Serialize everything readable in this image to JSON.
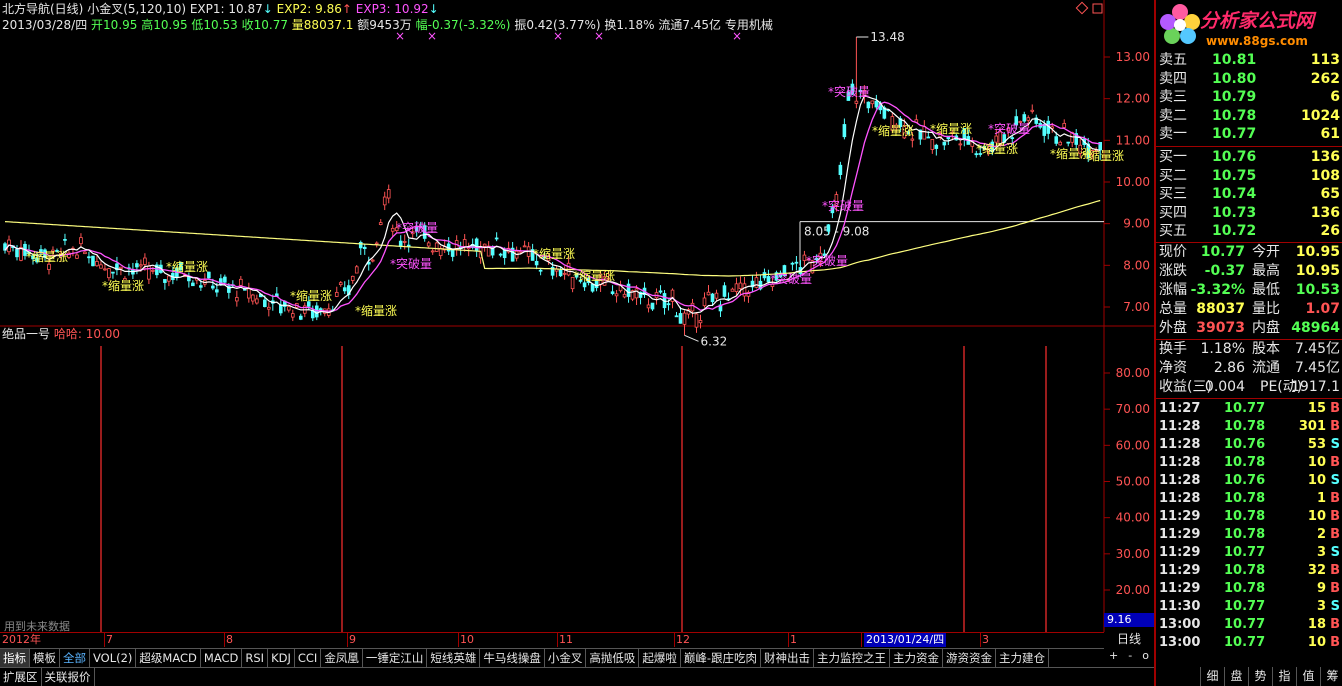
{
  "header": {
    "title": "北方导航(日线)",
    "indicator": "小金叉(5,120,10)",
    "exp1_label": "EXP1: 10.87",
    "exp1_arrow": "↓",
    "exp2_label": "EXP2: 9.86",
    "exp2_arrow": "↑",
    "exp3_label": "EXP3: 10.92",
    "exp3_arrow": "↓",
    "date": "2013/03/28/四",
    "open": "开10.95",
    "high": "高10.95",
    "low": "低10.53",
    "close": "收10.77",
    "volume": "量88037.1",
    "amount": "额9453万",
    "change": "幅-0.37(-3.32%)",
    "amplitude": "振0.42(3.77%)",
    "turnover": "换1.18%",
    "float": "流通7.45亿",
    "sector": "专用机械"
  },
  "sub": {
    "name": "绝品一号",
    "value": "哈哈: 10.00",
    "note": "用到未来数据"
  },
  "price_axis": [
    "13.00",
    "12.00",
    "11.00",
    "10.00",
    "9.00",
    "8.00",
    "7.00"
  ],
  "sub_axis": [
    "80.00",
    "70.00",
    "60.00",
    "50.00",
    "40.00",
    "30.00",
    "20.00"
  ],
  "sub_axis_last": "9.16",
  "annotations": {
    "high_label": "13.48",
    "low_label": "6.32",
    "range_label": "8.05 - 9.08",
    "shrink_up": "缩量涨",
    "breakout": "突破量"
  },
  "dates": {
    "labels": [
      "2012年",
      "7",
      "8",
      "9",
      "10",
      "11",
      "12",
      "1",
      "2",
      "3"
    ],
    "highlight": "2013/01/24/四",
    "period": "日线"
  },
  "zoom": [
    "+",
    "-",
    "o"
  ],
  "tabs": [
    "指标",
    "模板",
    "全部",
    "VOL(2)",
    "超级MACD",
    "MACD",
    "RSI",
    "KDJ",
    "CCI",
    "金凤凰",
    "一锤定江山",
    "短线英雄",
    "牛马线操盘",
    "小金叉",
    "高抛低吸",
    "起爆啦",
    "巅峰-跟庄吃肉",
    "财神出击",
    "主力监控之王",
    "主力资金",
    "游资资金",
    "主力建仓"
  ],
  "bottom_tabs": [
    "扩展区",
    "关联报价"
  ],
  "logo": {
    "text": "分析家公式网",
    "url": "www.88gs.com"
  },
  "orders": {
    "sell": [
      {
        "label": "卖五",
        "price": "10.81",
        "vol": "113"
      },
      {
        "label": "卖四",
        "price": "10.80",
        "vol": "262"
      },
      {
        "label": "卖三",
        "price": "10.79",
        "vol": "6"
      },
      {
        "label": "卖二",
        "price": "10.78",
        "vol": "1024"
      },
      {
        "label": "卖一",
        "price": "10.77",
        "vol": "61"
      }
    ],
    "buy": [
      {
        "label": "买一",
        "price": "10.76",
        "vol": "136"
      },
      {
        "label": "买二",
        "price": "10.75",
        "vol": "108"
      },
      {
        "label": "买三",
        "price": "10.74",
        "vol": "65"
      },
      {
        "label": "买四",
        "price": "10.73",
        "vol": "136"
      },
      {
        "label": "买五",
        "price": "10.72",
        "vol": "26"
      }
    ]
  },
  "quote": [
    {
      "l1": "现价",
      "v1": "10.77",
      "c1": "#54ff54",
      "l2": "今开",
      "v2": "10.95",
      "c2": "#ffff54"
    },
    {
      "l1": "涨跌",
      "v1": "-0.37",
      "c1": "#54ff54",
      "l2": "最高",
      "v2": "10.95",
      "c2": "#ffff54"
    },
    {
      "l1": "涨幅",
      "v1": "-3.32%",
      "c1": "#54ff54",
      "l2": "最低",
      "v2": "10.53",
      "c2": "#54ff54"
    },
    {
      "l1": "总量",
      "v1": "88037",
      "c1": "#ffff54",
      "l2": "量比",
      "v2": "1.07",
      "c2": "#ff5454"
    },
    {
      "l1": "外盘",
      "v1": "39073",
      "c1": "#ff5454",
      "l2": "内盘",
      "v2": "48964",
      "c2": "#54ff54"
    }
  ],
  "stats": [
    {
      "l1": "换手",
      "v1": "1.18%",
      "l2": "股本",
      "v2": "7.45亿"
    },
    {
      "l1": "净资",
      "v1": "2.86",
      "l2": "流通",
      "v2": "7.45亿"
    },
    {
      "l1": "收益(三)",
      "v1": "0.004",
      "l2": "PE(动)",
      "v2": "1917.1"
    }
  ],
  "ticks": [
    {
      "t": "11:27",
      "p": "10.77",
      "v": "15",
      "s": "B"
    },
    {
      "t": "11:28",
      "p": "10.78",
      "v": "301",
      "s": "B"
    },
    {
      "t": "11:28",
      "p": "10.76",
      "v": "53",
      "s": "S"
    },
    {
      "t": "11:28",
      "p": "10.78",
      "v": "10",
      "s": "B"
    },
    {
      "t": "11:28",
      "p": "10.76",
      "v": "10",
      "s": "S"
    },
    {
      "t": "11:28",
      "p": "10.78",
      "v": "1",
      "s": "B"
    },
    {
      "t": "11:29",
      "p": "10.78",
      "v": "10",
      "s": "B"
    },
    {
      "t": "11:29",
      "p": "10.78",
      "v": "2",
      "s": "B"
    },
    {
      "t": "11:29",
      "p": "10.77",
      "v": "3",
      "s": "S"
    },
    {
      "t": "11:29",
      "p": "10.78",
      "v": "32",
      "s": "B"
    },
    {
      "t": "11:29",
      "p": "10.78",
      "v": "9",
      "s": "B"
    },
    {
      "t": "11:30",
      "p": "10.77",
      "v": "3",
      "s": "S"
    },
    {
      "t": "13:00",
      "p": "10.77",
      "v": "18",
      "s": "B"
    },
    {
      "t": "13:00",
      "p": "10.77",
      "v": "10",
      "s": "B"
    }
  ],
  "bottom_icons": [
    "细",
    "盘",
    "势",
    "指",
    "值",
    "筹"
  ],
  "colors": {
    "up": "#ff5454",
    "down": "#54ffff",
    "ma_short": "#ffffff",
    "ma_mid": "#ff54ff",
    "ma_long": "#ffff80",
    "axis": "#a00000"
  }
}
